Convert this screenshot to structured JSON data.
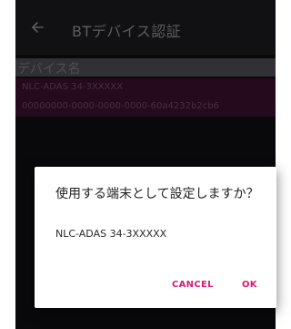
{
  "appbar": {
    "title": "BTデバイス認証",
    "back_icon": "back-arrow-icon"
  },
  "list": {
    "header": "デバイス名",
    "items": [
      {
        "name": "NLC-ADAS 34-3XXXXX",
        "uuid": "00000000-0000-0000-0000-60a4232b2cb6"
      }
    ]
  },
  "dialog": {
    "message": "使用する端末として設定しますか？",
    "device": "NLC-ADAS 34-3XXXXX",
    "cancel_label": "CANCEL",
    "ok_label": "OK"
  },
  "colors": {
    "accent": "#d81b73",
    "selected_row": "#3a0f2c",
    "background": "#0e0e11"
  }
}
